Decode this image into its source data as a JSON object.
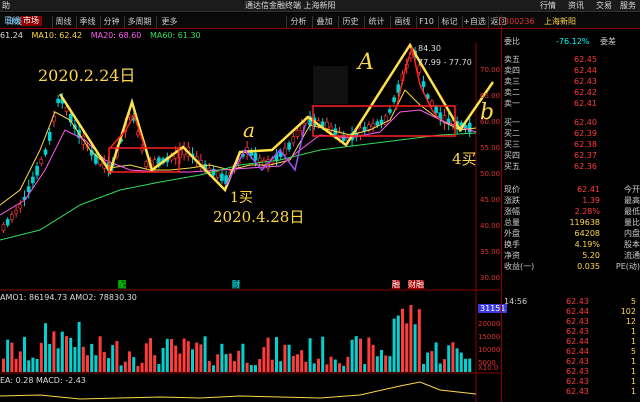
{
  "titlebar": {
    "left_text": "助",
    "center_title": "通达信金融终端 上海新阳",
    "menu": [
      "行情",
      "资讯",
      "交易",
      "服务"
    ]
  },
  "tabs": {
    "active": "市场"
  },
  "toolbar": {
    "left": [
      "日线",
      "周线",
      "季线",
      "分钟",
      "多周期",
      "更多"
    ],
    "right": [
      "分析",
      "叠加",
      "历史",
      "统计",
      "画线",
      "F10",
      "标记",
      "+自选",
      "返回"
    ]
  },
  "ma_line": {
    "prefix": "61.24",
    "ma10": "MA10: 62.42",
    "ma20": "MA20: 68.60",
    "ma60": "MA60: 61.30"
  },
  "chart_labels": {
    "high": "84.30",
    "range": "77.99 - 77.70",
    "marker_left": "配",
    "marker_mid": "财",
    "marker_right1": "融",
    "marker_right2": "财融"
  },
  "price_axis": [
    "70.00",
    "65.00",
    "60.00",
    "55.00",
    "50.00",
    "45.00",
    "40.00",
    "35.00",
    "30.00"
  ],
  "vol_line": {
    "text": "AMO1: 86194.73  AMO2: 78830.30",
    "badge": "31151"
  },
  "vol_axis": [
    "20000",
    "15000",
    "10000",
    "5000"
  ],
  "vol_axis_unit": "X10.0",
  "macd_line": {
    "text": "EA: 0.28  MACD: -2.43"
  },
  "annotations": {
    "date1": "2020.2.24日",
    "date2": "2020.4.28日",
    "buy1": "1买",
    "buy4": "4买",
    "a_small": "a",
    "a_big": "A",
    "b": "b"
  },
  "quote": {
    "code": "300236",
    "name": "上海新阳",
    "weibi_label": "委比",
    "weibi_value": "-76.12%",
    "weicha_label": "委差",
    "asks": [
      {
        "label": "卖五",
        "price": "62.45"
      },
      {
        "label": "卖四",
        "price": "62.44"
      },
      {
        "label": "卖三",
        "price": "62.43"
      },
      {
        "label": "卖二",
        "price": "62.42"
      },
      {
        "label": "卖一",
        "price": "62.41"
      }
    ],
    "bids": [
      {
        "label": "买一",
        "price": "62.40"
      },
      {
        "label": "买二",
        "price": "62.39"
      },
      {
        "label": "买三",
        "price": "62.38"
      },
      {
        "label": "买四",
        "price": "62.37"
      },
      {
        "label": "买五",
        "price": "62.36"
      }
    ],
    "stats": [
      {
        "l1": "现价",
        "v1": "62.41",
        "l2": "今开"
      },
      {
        "l1": "涨跌",
        "v1": "1.39",
        "l2": "最高"
      },
      {
        "l1": "涨幅",
        "v1": "2.28%",
        "l2": "最低"
      },
      {
        "l1": "总量",
        "v1": "119638",
        "l2": "量比"
      },
      {
        "l1": "外盘",
        "v1": "64208",
        "l2": "内盘"
      },
      {
        "l1": "换手",
        "v1": "4.19%",
        "l2": "股本"
      },
      {
        "l1": "净资",
        "v1": "5.20",
        "l2": "流通"
      },
      {
        "l1": "收益(一)",
        "v1": "0.035",
        "l2": "PE(动)"
      }
    ],
    "ticks": [
      {
        "time": "14:56",
        "price": "62.43",
        "vol": "5"
      },
      {
        "time": "",
        "price": "62.44",
        "vol": "102"
      },
      {
        "time": "",
        "price": "62.43",
        "vol": "12"
      },
      {
        "time": "",
        "price": "62.43",
        "vol": "1"
      },
      {
        "time": "",
        "price": "62.44",
        "vol": "1"
      },
      {
        "time": "",
        "price": "62.44",
        "vol": "5"
      },
      {
        "time": "",
        "price": "62.43",
        "vol": "1"
      },
      {
        "time": "",
        "price": "62.43",
        "vol": "1"
      },
      {
        "time": "",
        "price": "62.43",
        "vol": "1"
      },
      {
        "time": "",
        "price": "62.43",
        "vol": "1"
      }
    ]
  },
  "colors": {
    "up": "#ff3b3b",
    "down": "#00d2d2",
    "yellow": "#ffd84a",
    "border": "#8b0000"
  }
}
